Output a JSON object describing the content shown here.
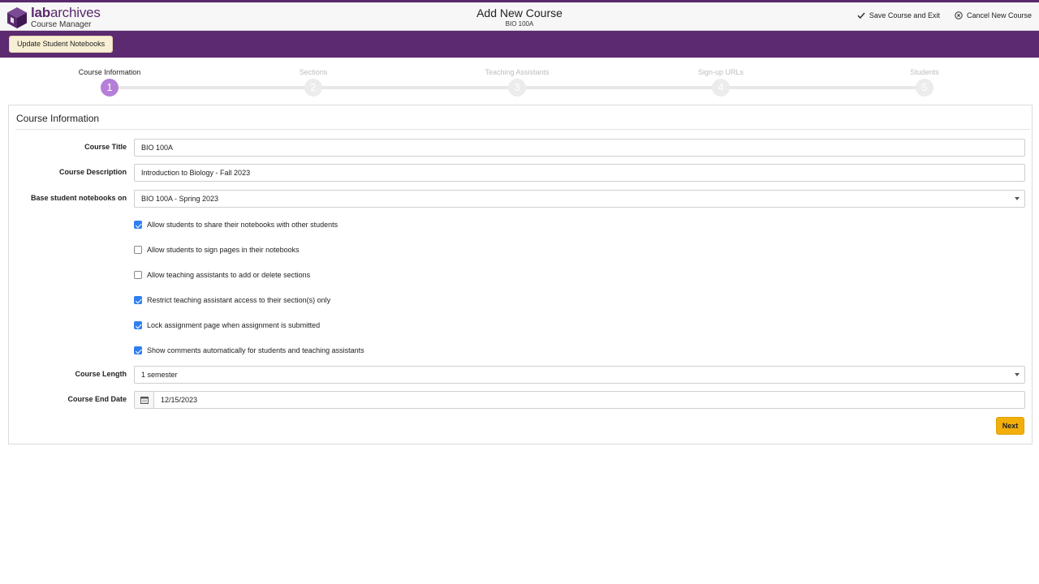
{
  "header": {
    "brand_bold": "lab",
    "brand_rest": "archives",
    "subtitle": "Course Manager",
    "title": "Add New Course",
    "course_code": "BIO 100A",
    "save_exit_label": "Save Course and Exit",
    "cancel_label": "Cancel New Course",
    "brand_color": "#5a2a6e"
  },
  "toolbar": {
    "update_label": "Update Student Notebooks",
    "bar_color": "#5c2a70"
  },
  "steps": [
    {
      "label": "Course Information",
      "number": "1",
      "active": true
    },
    {
      "label": "Sections",
      "number": "2",
      "active": false
    },
    {
      "label": "Teaching Assistants",
      "number": "3",
      "active": false
    },
    {
      "label": "Sign-up URLs",
      "number": "4",
      "active": false
    },
    {
      "label": "Students",
      "number": "5",
      "active": false
    }
  ],
  "panel": {
    "heading": "Course Information"
  },
  "form": {
    "course_title_label": "Course Title",
    "course_title_value": "BIO 100A",
    "course_description_label": "Course Description",
    "course_description_value": "Introduction to Biology - Fall 2023",
    "base_notebooks_label": "Base student notebooks on",
    "base_notebooks_value": "BIO 100A - Spring 2023",
    "checkboxes": [
      {
        "label": "Allow students to share their notebooks with other students",
        "checked": true
      },
      {
        "label": "Allow students to sign pages in their notebooks",
        "checked": false
      },
      {
        "label": "Allow teaching assistants to add or delete sections",
        "checked": false
      },
      {
        "label": "Restrict teaching assistant access to their section(s) only",
        "checked": true
      },
      {
        "label": "Lock assignment page when assignment is submitted",
        "checked": true
      },
      {
        "label": "Show comments automatically for students and teaching assistants",
        "checked": true
      }
    ],
    "course_length_label": "Course Length",
    "course_length_value": "1 semester",
    "course_end_label": "Course End Date",
    "course_end_value": "12/15/2023",
    "next_label": "Next"
  },
  "colors": {
    "active_step": "#b57fd8",
    "checkbox_on": "#2f7ff0",
    "next_button": "#f2ae0a"
  },
  "icons": {
    "logo": "cube-logo-icon",
    "save": "check-icon",
    "cancel": "circle-x-icon",
    "date": "calendar-icon",
    "select": "caret-down-icon"
  }
}
